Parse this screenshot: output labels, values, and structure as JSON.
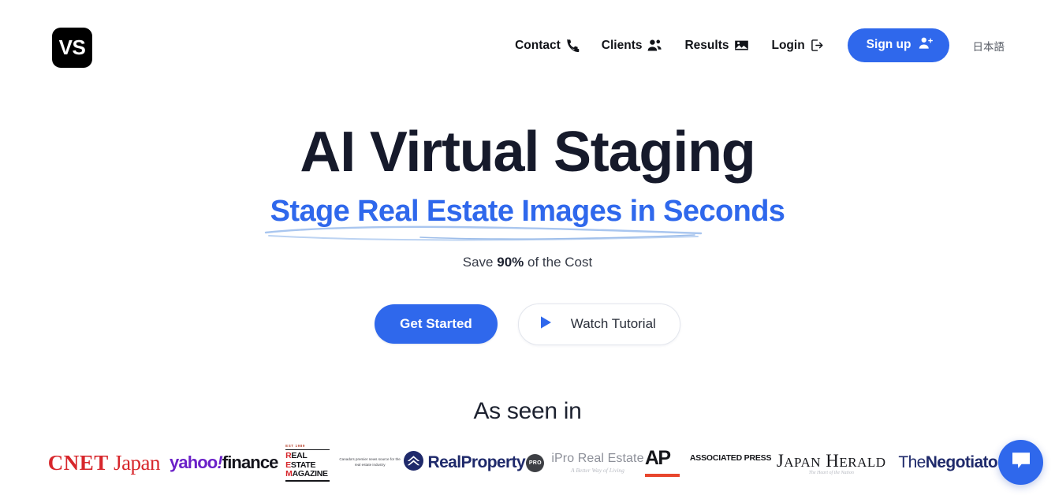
{
  "header": {
    "logo_text": "VS",
    "nav": [
      {
        "label": "Contact",
        "icon": "phone-icon"
      },
      {
        "label": "Clients",
        "icon": "people-icon"
      },
      {
        "label": "Results",
        "icon": "image-icon"
      },
      {
        "label": "Login",
        "icon": "login-icon"
      }
    ],
    "signup_label": "Sign up",
    "signup_icon": "person-add-icon",
    "language_label": "日本語",
    "accent_color": "#2f68ec"
  },
  "hero": {
    "title": "AI Virtual Staging",
    "subtitle": "Stage Real Estate Images in Seconds",
    "save_prefix": "Save ",
    "save_value": "90%",
    "save_suffix": " of the Cost",
    "primary_cta": "Get Started",
    "secondary_cta": "Watch Tutorial",
    "secondary_icon": "play-icon",
    "title_color": "#161a2b",
    "subtitle_color": "#2f68ec"
  },
  "press": {
    "heading": "As seen in",
    "logos": [
      {
        "name": "cnet-japan",
        "bold_text": "CNET",
        "regular_text": "Japan",
        "color": "#d7262b"
      },
      {
        "name": "yahoo-finance",
        "part1": "yahoo",
        "bang": "!",
        "part2": "finance",
        "color1": "#6b21c8",
        "color2": "#14141c"
      },
      {
        "name": "real-estate-magazine",
        "est": "EST 1989",
        "line1_accent": "R",
        "line1_rest": "EAL",
        "line2_accent": "E",
        "line2_rest": "STATE",
        "line3_accent": "M",
        "line3_rest": "AGAZINE",
        "tagline": "Canada's premier news source for the real estate industry"
      },
      {
        "name": "realproperty",
        "text": "RealProperty",
        "color": "#1f2a6b"
      },
      {
        "name": "ipro-real-estate",
        "badge": "PRO",
        "text": "iPro Real Estate",
        "tagline": "A Better Way of Living"
      },
      {
        "name": "associated-press",
        "mark": "AP",
        "text": "ASSOCIATED PRESS",
        "bar_color": "#e8462d"
      },
      {
        "name": "japan-herald",
        "word1_cap": "J",
        "word1_rest": "APAN",
        "word2_cap": "H",
        "word2_rest": "ERALD",
        "tagline": "The Heart of the Nation"
      },
      {
        "name": "the-negotiator",
        "thin_text": "The",
        "bold_text": "Negotiator",
        "color": "#1f2a6b"
      }
    ]
  },
  "chat": {
    "icon": "chat-bubble-icon",
    "color": "#2f68ec"
  }
}
